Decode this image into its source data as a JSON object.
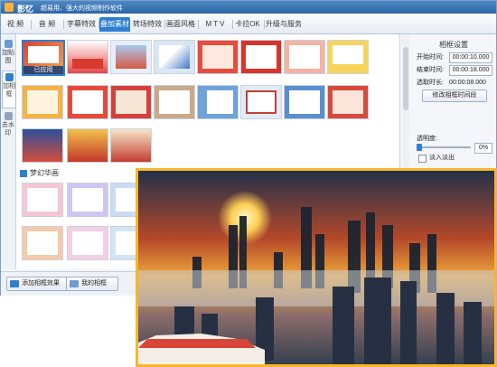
{
  "title": {
    "app_name": "影忆",
    "slogan": "超易用、强大的视频制作软件"
  },
  "tabs": [
    {
      "label": "视 频"
    },
    {
      "label": "音 频"
    },
    {
      "label": "字幕特效"
    },
    {
      "label": "叠加素材",
      "active": true
    },
    {
      "label": "转场特效"
    },
    {
      "label": "画面风格"
    },
    {
      "label": "M T V"
    },
    {
      "label": "卡拉OK"
    },
    {
      "label": "升级与服务"
    }
  ],
  "sidebar": {
    "items": [
      {
        "label": "加贴图",
        "icon": "sticker-icon"
      },
      {
        "label": "加相框",
        "icon": "frame-icon",
        "active": true
      },
      {
        "label": "去水印",
        "icon": "watermark-icon"
      }
    ]
  },
  "frames": {
    "applied_label": "已应用",
    "section_title": "梦幻华画"
  },
  "panel": {
    "title": "相框设置",
    "start_label": "开始时间:",
    "start_value": "00:00:10.000",
    "end_label": "结束时间:",
    "end_value": "00:00:18.000",
    "duration_label": "选取时长:",
    "duration_value": "00:00:08.000",
    "modify_button": "修改相框时间段",
    "opacity_label": "透明度:",
    "opacity_value": "0%",
    "fade_label": "淡入淡出"
  },
  "bottom": {
    "add_button": "添加相框效果",
    "mine_button": "我的相框"
  },
  "colors": {
    "accent": "#2f7fd1",
    "preview_border": "#f7b62a",
    "title_bar": "#2d65a6"
  }
}
